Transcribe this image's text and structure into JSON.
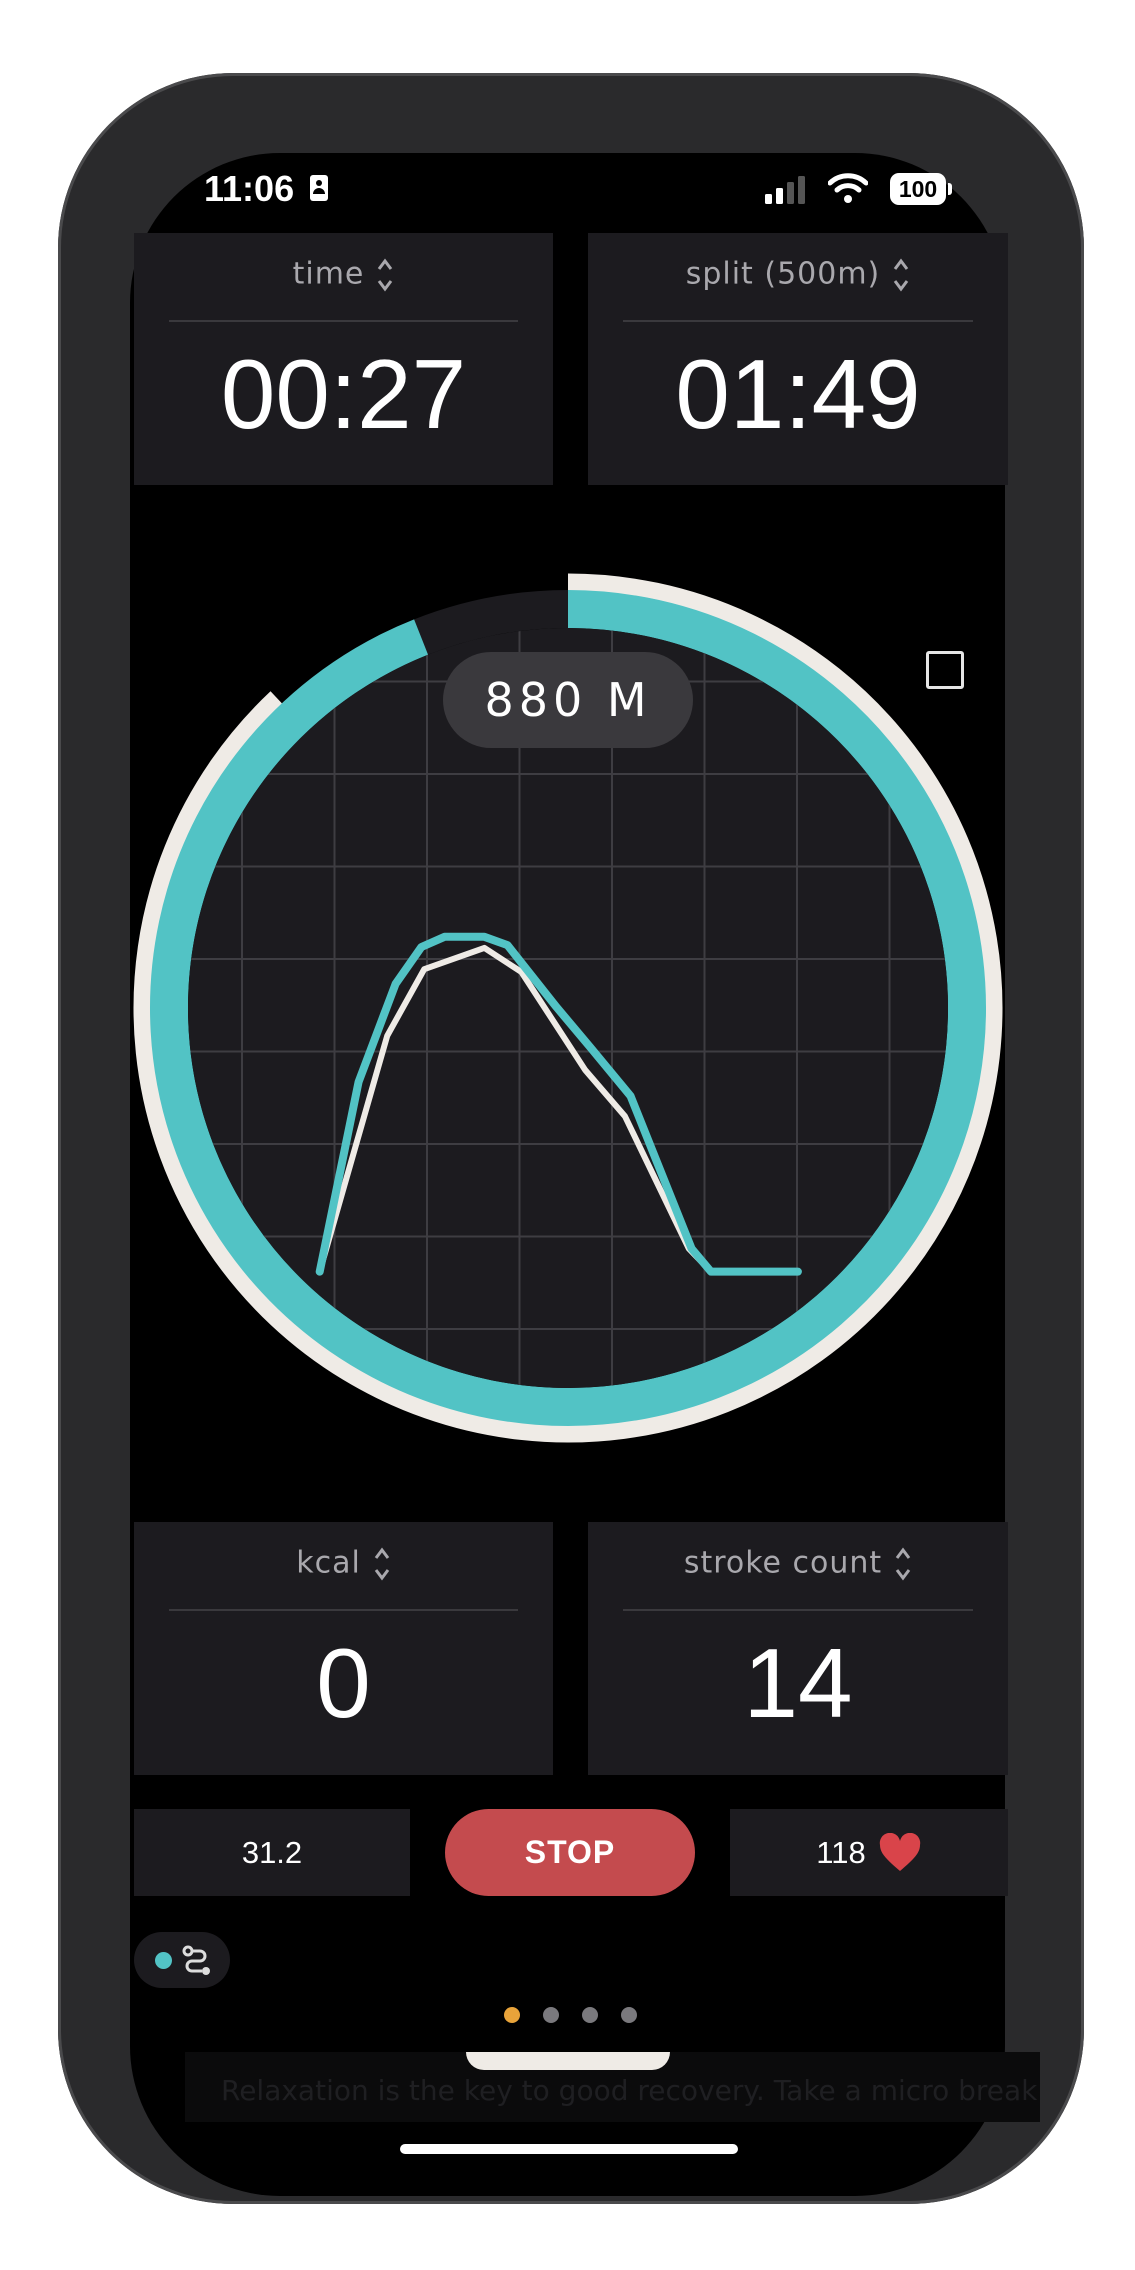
{
  "status_bar": {
    "time": "11:06",
    "battery": "100"
  },
  "metrics_top": [
    {
      "label": "time",
      "value": "00:27"
    },
    {
      "label": "split (500m)",
      "value": "01:49"
    }
  ],
  "ring": {
    "distance_label": "880 M",
    "progress_teal_fraction": 0.94,
    "progress_white_fraction": 0.88,
    "colors": {
      "teal": "#52c3c5",
      "white": "#efebe6",
      "track": "#1c1b1f"
    }
  },
  "chart_data": {
    "type": "line",
    "grid": true,
    "series": [
      {
        "color": "#52c3c5",
        "points": [
          [
            0.84,
            0.62
          ],
          [
            1.26,
            2.67
          ],
          [
            1.66,
            3.73
          ],
          [
            1.94,
            4.13
          ],
          [
            2.19,
            4.24
          ],
          [
            2.62,
            4.24
          ],
          [
            2.87,
            4.15
          ],
          [
            3.4,
            3.48
          ],
          [
            3.77,
            3.04
          ],
          [
            4.2,
            2.52
          ],
          [
            4.86,
            0.87
          ],
          [
            5.07,
            0.62
          ],
          [
            6.01,
            0.62
          ]
        ]
      },
      {
        "color": "#efebe6",
        "points": [
          [
            0.84,
            0.62
          ],
          [
            1.57,
            3.17
          ],
          [
            1.97,
            3.89
          ],
          [
            2.62,
            4.12
          ],
          [
            3.02,
            3.86
          ],
          [
            3.71,
            2.8
          ],
          [
            4.14,
            2.3
          ],
          [
            4.83,
            0.87
          ],
          [
            5.07,
            0.62
          ]
        ]
      }
    ]
  },
  "metrics_bottom": [
    {
      "label": "kcal",
      "value": "0"
    },
    {
      "label": "stroke count",
      "value": "14"
    }
  ],
  "controls": {
    "left_value": "31.2",
    "stop_label": "STOP",
    "heart_rate": "118",
    "heart_color": "#d9444a"
  },
  "pager": {
    "count": 4,
    "active": 0,
    "active_color": "#e8a33a"
  },
  "tip_text": "Relaxation is the key to good recovery. Take a micro break"
}
